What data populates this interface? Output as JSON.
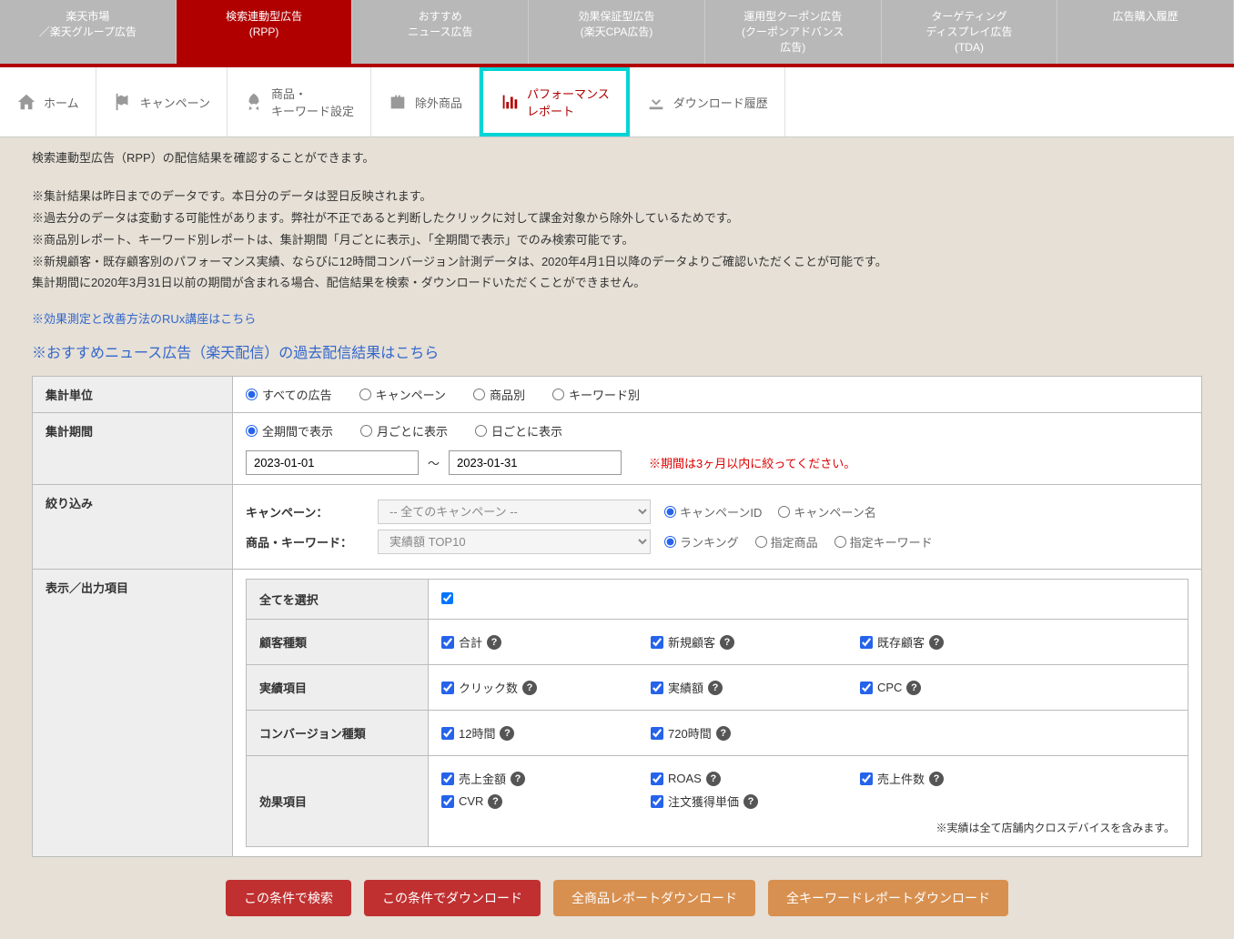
{
  "topTabs": [
    {
      "l1": "楽天市場",
      "l2": "／楽天グループ広告"
    },
    {
      "l1": "検索連動型広告",
      "l2": "(RPP)"
    },
    {
      "l1": "おすすめ",
      "l2": "ニュース広告"
    },
    {
      "l1": "効果保証型広告",
      "l2": "(楽天CPA広告)"
    },
    {
      "l1": "運用型クーポン広告",
      "l2": "(クーポンアドバンス",
      "l3": "広告)"
    },
    {
      "l1": "ターゲティング",
      "l2": "ディスプレイ広告",
      "l3": "(TDA)"
    },
    {
      "l1": "広告購入履歴",
      "l2": ""
    }
  ],
  "subTabs": {
    "home": "ホーム",
    "campaign": "キャンペーン",
    "product1": "商品・",
    "product2": "キーワード設定",
    "exclude": "除外商品",
    "perf1": "パフォーマンス",
    "perf2": "レポート",
    "download": "ダウンロード履歴"
  },
  "desc": {
    "p1": "検索連動型広告（RPP）の配信結果を確認することができます。",
    "p2": "※集計結果は昨日までのデータです。本日分のデータは翌日反映されます。",
    "p3": "※過去分のデータは変動する可能性があります。弊社が不正であると判断したクリックに対して課金対象から除外しているためです。",
    "p4": "※商品別レポート、キーワード別レポートは、集計期間「月ごとに表示」、「全期間で表示」でのみ検索可能です。",
    "p5": "※新規顧客・既存顧客別のパフォーマンス実績、ならびに12時間コンバージョン計測データは、2020年4月1日以降のデータよりご確認いただくことが可能です。",
    "p6": "集計期間に2020年3月31日以前の期間が含まれる場合、配信結果を検索・ダウンロードいただくことができません。",
    "link1": "※効果測定と改善方法のRUx講座はこちら",
    "link2": "※おすすめニュース広告（楽天配信）の過去配信結果はこちら"
  },
  "labels": {
    "unit": "集計単位",
    "period": "集計期間",
    "filter": "絞り込み",
    "output": "表示／出力項目",
    "campaignLabel": "キャンペーン：",
    "productLabel": "商品・キーワード：",
    "tilde": "～",
    "dateWarn": "※期間は3ヶ月以内に絞ってください。"
  },
  "unitOptions": [
    "すべての広告",
    "キャンペーン",
    "商品別",
    "キーワード別"
  ],
  "periodOptions": [
    "全期間で表示",
    "月ごとに表示",
    "日ごとに表示"
  ],
  "dates": {
    "from": "2023-01-01",
    "to": "2023-01-31"
  },
  "campaignSelect": "-- 全てのキャンペーン --",
  "campaignFilterOpts": [
    "キャンペーンID",
    "キャンペーン名"
  ],
  "productSelect": "実績額 TOP10",
  "productFilterOpts": [
    "ランキング",
    "指定商品",
    "指定キーワード"
  ],
  "outRows": {
    "all": "全てを選択",
    "customer": {
      "h": "顧客種類",
      "items": [
        "合計",
        "新規顧客",
        "既存顧客"
      ]
    },
    "actual": {
      "h": "実績項目",
      "items": [
        "クリック数",
        "実績額",
        "CPC"
      ]
    },
    "conv": {
      "h": "コンバージョン種類",
      "items": [
        "12時間",
        "720時間"
      ]
    },
    "effect": {
      "h": "効果項目",
      "items": [
        "売上金額",
        "ROAS",
        "売上件数",
        "CVR",
        "注文獲得単価"
      ]
    },
    "note": "※実績は全て店舗内クロスデバイスを含みます。"
  },
  "buttons": {
    "search": "この条件で検索",
    "download": "この条件でダウンロード",
    "allProducts": "全商品レポートダウンロード",
    "allKeywords": "全キーワードレポートダウンロード"
  }
}
